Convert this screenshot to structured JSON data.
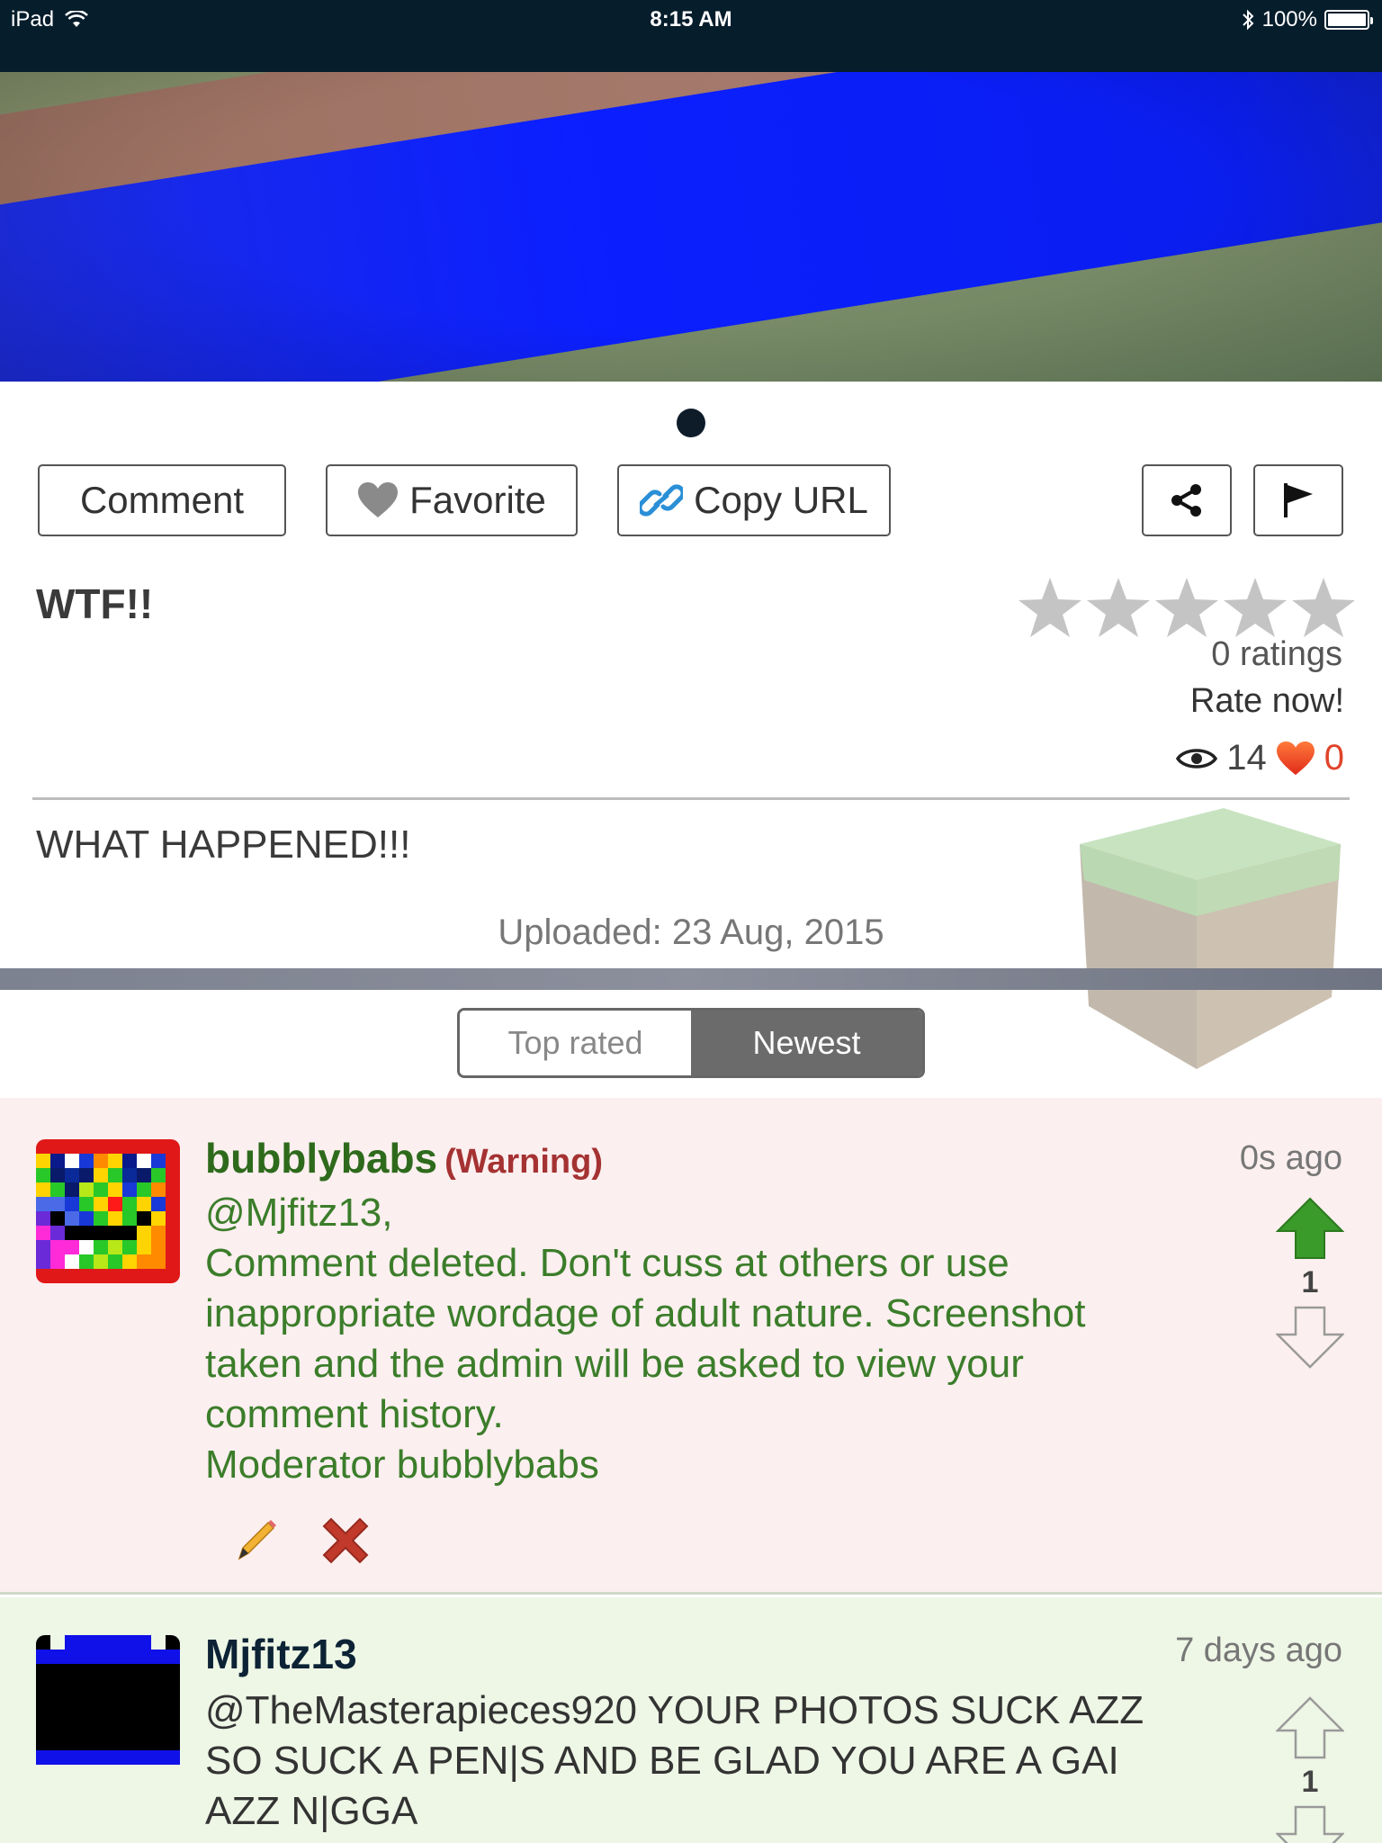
{
  "status_bar": {
    "device": "iPad",
    "time": "8:15 AM",
    "battery": "100%"
  },
  "toolbar": {
    "comment": "Comment",
    "favorite": "Favorite",
    "copy_url": "Copy URL"
  },
  "post": {
    "title": "WTF!!",
    "ratings": "0 ratings",
    "rate_now": "Rate now!",
    "views": "14",
    "likes": "0",
    "description": "WHAT HAPPENED!!!",
    "uploaded": "Uploaded: 23 Aug, 2015",
    "rating_value": 0
  },
  "sort": {
    "top_rated": "Top rated",
    "newest": "Newest",
    "selected": "Newest"
  },
  "comments": [
    {
      "user": "bubblybabs",
      "badge": "(Warning)",
      "time": "0s ago",
      "lines": [
        "@Mjfitz13,",
        "Comment deleted. Don't cuss at others or use",
        "inappropriate wordage of adult nature. Screenshot",
        "taken and the admin will be asked to view your",
        "comment history.",
        "Moderator bubblybabs"
      ],
      "votes": "1"
    },
    {
      "user": "Mjfitz13",
      "time": "7 days ago",
      "lines": [
        "@TheMasterapieces920 YOUR PHOTOS SUCK AZZ",
        "SO SUCK A PEN|S AND BE GLAD YOU ARE A GAI",
        "AZZ N|GGA"
      ],
      "votes": "1"
    }
  ],
  "colors": {
    "status_bar": "#061d2c",
    "like_red": "#e0442a",
    "moderator_green": "#3b7d2a",
    "upvote_green": "#3a9a2a"
  }
}
